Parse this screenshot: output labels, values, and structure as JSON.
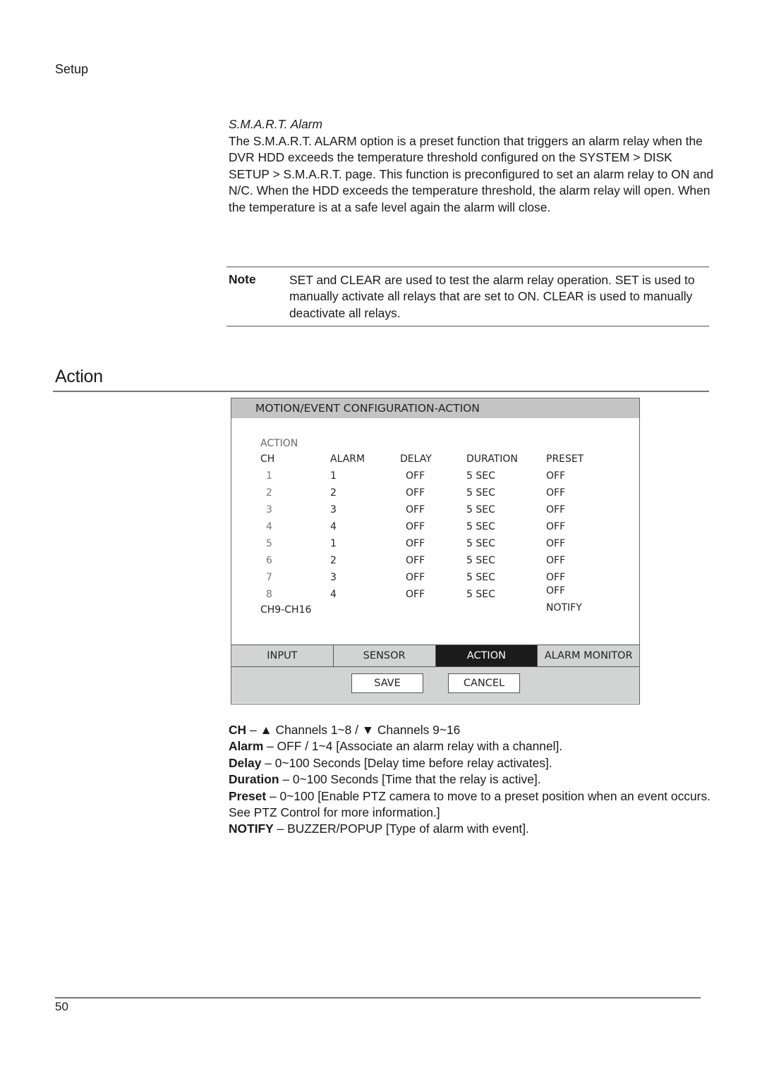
{
  "running_head": "Setup",
  "smart_alarm": {
    "title": "S.M.A.R.T. Alarm",
    "paragraph": "The S.M.A.R.T. ALARM option is a preset function that triggers an alarm relay when the DVR HDD exceeds the temperature threshold configured on the SYSTEM > DISK SETUP > S.M.A.R.T. page. This function is preconfigured to set an alarm relay to ON and N/C. When the HDD exceeds the temperature threshold, the alarm relay will open. When the temperature is at a safe level again the alarm will close."
  },
  "note": {
    "label": "Note",
    "text": "SET and CLEAR are used to test the alarm relay operation. SET is used to manually activate all relays that are set to ON. CLEAR is used to manually deactivate all relays."
  },
  "section_title": "Action",
  "dialog": {
    "title": "MOTION/EVENT CONFIGURATION-ACTION",
    "section_label": "ACTION",
    "columns": [
      "CH",
      "ALARM",
      "DELAY",
      "DURATION",
      "PRESET"
    ],
    "rows": [
      {
        "ch": "1",
        "alarm": "1",
        "delay": "OFF",
        "duration": "5 SEC",
        "preset": "OFF"
      },
      {
        "ch": "2",
        "alarm": "2",
        "delay": "OFF",
        "duration": "5 SEC",
        "preset": "OFF"
      },
      {
        "ch": "3",
        "alarm": "3",
        "delay": "OFF",
        "duration": "5 SEC",
        "preset": "OFF"
      },
      {
        "ch": "4",
        "alarm": "4",
        "delay": "OFF",
        "duration": "5 SEC",
        "preset": "OFF"
      },
      {
        "ch": "5",
        "alarm": "1",
        "delay": "OFF",
        "duration": "5 SEC",
        "preset": "OFF"
      },
      {
        "ch": "6",
        "alarm": "2",
        "delay": "OFF",
        "duration": "5 SEC",
        "preset": "OFF"
      },
      {
        "ch": "7",
        "alarm": "3",
        "delay": "OFF",
        "duration": "5 SEC",
        "preset": "OFF"
      },
      {
        "ch": "8",
        "alarm": "4",
        "delay": "OFF",
        "duration": "5 SEC",
        "preset": "OFF"
      }
    ],
    "channel_page": "CH9-CH16",
    "notify_label": "NOTIFY",
    "tabs": [
      {
        "label": "INPUT",
        "active": false
      },
      {
        "label": "SENSOR",
        "active": false
      },
      {
        "label": "ACTION",
        "active": true
      },
      {
        "label": "ALARM MONITOR",
        "active": false
      }
    ],
    "save_label": "SAVE",
    "cancel_label": "CANCEL"
  },
  "descriptions": [
    {
      "term": "CH",
      "text": " – ▲ Channels 1~8 / ▼ Channels 9~16"
    },
    {
      "term": "Alarm",
      "text": " – OFF / 1~4 [Associate an alarm relay with a channel]."
    },
    {
      "term": "Delay",
      "text": " – 0~100 Seconds [Delay time before relay activates]."
    },
    {
      "term": "Duration",
      "text": " – 0~100 Seconds [Time that the relay is active]."
    },
    {
      "term": "Preset",
      "text": " – 0~100 [Enable PTZ camera to move to a preset position when an event occurs. See PTZ Control for more information.]"
    },
    {
      "term": "NOTIFY",
      "text": " – BUZZER/POPUP [Type of alarm with event]."
    }
  ],
  "page_number": "50"
}
